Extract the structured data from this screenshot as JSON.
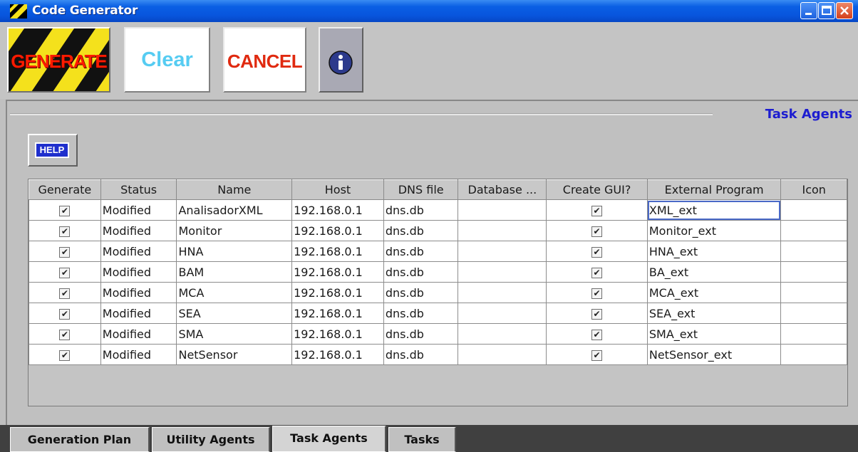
{
  "window": {
    "title": "Code Generator",
    "icon": "yellow-black-stripe-icon",
    "controls": [
      "minimize-icon",
      "maximize-icon",
      "close-icon"
    ]
  },
  "toolbar": {
    "generate_label": "GENERATE",
    "clear_label": "Clear",
    "cancel_label": "CANCEL",
    "info_icon": "info-icon"
  },
  "section": {
    "title": "Task Agents",
    "help_label": "HELP"
  },
  "table": {
    "columns": [
      "Generate",
      "Status",
      "Name",
      "Host",
      "DNS file",
      "Database ...",
      "Create GUI?",
      "External Program",
      "Icon"
    ],
    "rows": [
      {
        "generate": true,
        "status": "Modified",
        "name": "AnalisadorXML",
        "host": "192.168.0.1",
        "dns": "dns.db",
        "database": "",
        "gui": true,
        "external": "XML_ext",
        "icon": ""
      },
      {
        "generate": true,
        "status": "Modified",
        "name": "Monitor",
        "host": "192.168.0.1",
        "dns": "dns.db",
        "database": "",
        "gui": true,
        "external": "Monitor_ext",
        "icon": ""
      },
      {
        "generate": true,
        "status": "Modified",
        "name": "HNA",
        "host": "192.168.0.1",
        "dns": "dns.db",
        "database": "",
        "gui": true,
        "external": "HNA_ext",
        "icon": ""
      },
      {
        "generate": true,
        "status": "Modified",
        "name": "BAM",
        "host": "192.168.0.1",
        "dns": "dns.db",
        "database": "",
        "gui": true,
        "external": "BA_ext",
        "icon": ""
      },
      {
        "generate": true,
        "status": "Modified",
        "name": "MCA",
        "host": "192.168.0.1",
        "dns": "dns.db",
        "database": "",
        "gui": true,
        "external": "MCA_ext",
        "icon": ""
      },
      {
        "generate": true,
        "status": "Modified",
        "name": "SEA",
        "host": "192.168.0.1",
        "dns": "dns.db",
        "database": "",
        "gui": true,
        "external": "SEA_ext",
        "icon": ""
      },
      {
        "generate": true,
        "status": "Modified",
        "name": "SMA",
        "host": "192.168.0.1",
        "dns": "dns.db",
        "database": "",
        "gui": true,
        "external": "SMA_ext",
        "icon": ""
      },
      {
        "generate": true,
        "status": "Modified",
        "name": "NetSensor",
        "host": "192.168.0.1",
        "dns": "dns.db",
        "database": "",
        "gui": true,
        "external": "NetSensor_ext",
        "icon": ""
      }
    ]
  },
  "tabs": [
    {
      "label": "Generation Plan",
      "selected": false
    },
    {
      "label": "Utility Agents",
      "selected": false
    },
    {
      "label": "Task Agents",
      "selected": true
    },
    {
      "label": "Tasks",
      "selected": false
    }
  ],
  "colors": {
    "titlebar": "#0855dd",
    "section_title": "#1d1dd0",
    "generate_text": "#ff1a00",
    "clear_text": "#56ccf2",
    "cancel_text": "#e02a10",
    "help_bg": "#1f2fcd"
  }
}
